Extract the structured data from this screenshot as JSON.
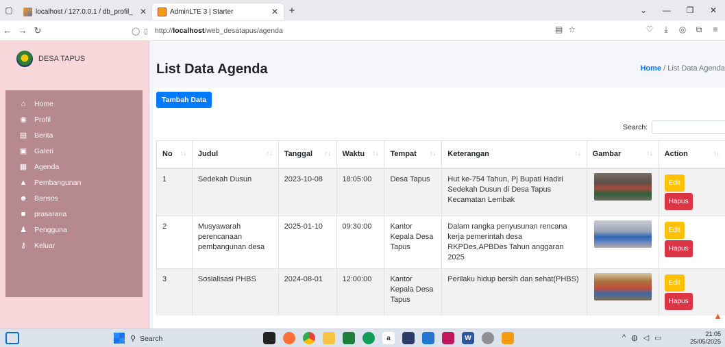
{
  "browser": {
    "tabs": [
      {
        "label": "localhost / 127.0.0.1 / db_profil_",
        "icon": "phpmyadmin-icon",
        "active": false
      },
      {
        "label": "AdminLTE 3 | Starter",
        "icon": "adminlte-icon",
        "active": true
      }
    ],
    "url_prefix": "http://",
    "url_host": "localhost",
    "url_path": "/web_desatapus/agenda"
  },
  "sidebar": {
    "brand": "DESA TAPUS",
    "items": [
      {
        "label": "Home",
        "icon": "home-icon",
        "glyph": "⌂"
      },
      {
        "label": "Profil",
        "icon": "user-circle-icon",
        "glyph": "◉"
      },
      {
        "label": "Berita",
        "icon": "newspaper-icon",
        "glyph": "▤"
      },
      {
        "label": "Galeri",
        "icon": "image-icon",
        "glyph": "▣"
      },
      {
        "label": "Agenda",
        "icon": "calendar-icon",
        "glyph": "▦"
      },
      {
        "label": "Pembangunan",
        "icon": "building-icon",
        "glyph": "▲"
      },
      {
        "label": "Bansos",
        "icon": "users-icon",
        "glyph": "☻"
      },
      {
        "label": "prasarana",
        "icon": "book-icon",
        "glyph": "■"
      },
      {
        "label": "Pengguna",
        "icon": "user-icon",
        "glyph": "♟"
      },
      {
        "label": "Keluar",
        "icon": "key-icon",
        "glyph": "⚷"
      }
    ]
  },
  "header": {
    "title": "List Data Agenda",
    "breadcrumb_home": "Home",
    "breadcrumb_sep": "/",
    "breadcrumb_current": "List Data Agenda"
  },
  "card": {
    "add_button": "Tambah Data",
    "search_label": "Search:",
    "search_value": ""
  },
  "table": {
    "columns": [
      "No",
      "Judul",
      "Tanggal",
      "Waktu",
      "Tempat",
      "Keterangan",
      "Gambar",
      "Action"
    ],
    "rows": [
      {
        "no": "1",
        "judul": "Sedekah Dusun",
        "tanggal": "2023-10-08",
        "waktu": "18:05:00",
        "tempat": "Desa Tapus",
        "keterangan": "Hut ke-754 Tahun, Pj Bupati Hadiri Sedekah Dusun di Desa Tapus Kecamatan Lembak"
      },
      {
        "no": "2",
        "judul": "Musyawarah perencanaan pembangunan desa",
        "tanggal": "2025-01-10",
        "waktu": "09:30:00",
        "tempat": "Kantor Kepala Desa Tapus",
        "keterangan": "Dalam rangka penyusunan rencana kerja pemerintah desa RKPDes,APBDes Tahun anggaran 2025"
      },
      {
        "no": "3",
        "judul": "Sosialisasi PHBS",
        "tanggal": "2024-08-01",
        "waktu": "12:00:00",
        "tempat": "Kantor Kepala Desa Tapus",
        "keterangan": "Perilaku hidup bersih dan sehat(PHBS)"
      }
    ],
    "edit_label": "Edit",
    "hapus_label": "Hapus"
  },
  "taskbar": {
    "search_placeholder": "Search",
    "time": "21:05",
    "date": "25/05/2025"
  }
}
